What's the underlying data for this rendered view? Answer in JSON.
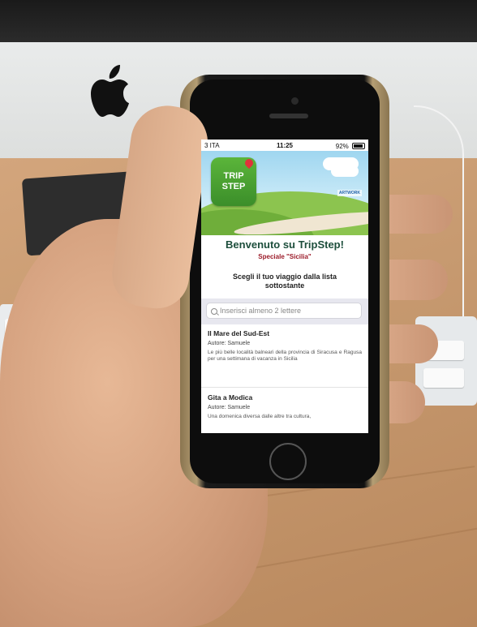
{
  "status_bar": {
    "carrier": "3 ITA",
    "time": "11:25",
    "battery": "92%"
  },
  "banner": {
    "logo_line1": "TRIP",
    "logo_line2": "STEP",
    "partner": "ARTWORK"
  },
  "welcome_title": "Benvenuto su TripStep!",
  "special_label": "Speciale \"Sicilia\"",
  "instruction": "Scegli il tuo viaggio dalla lista sottostante",
  "search": {
    "placeholder": "Inserisci almeno 2 lettere"
  },
  "trips": [
    {
      "title": "Il Mare del Sud-Est",
      "author": "Autore: Samuele",
      "description": "Le più belle località balneari della provincia di Siracusa e Ragusa per una settimana di vacanza in Sicilia"
    },
    {
      "title": "Gita a Modica",
      "author": "Autore: Samuele",
      "description": "Una domenica diversa dalle altre tra cultura,"
    }
  ]
}
